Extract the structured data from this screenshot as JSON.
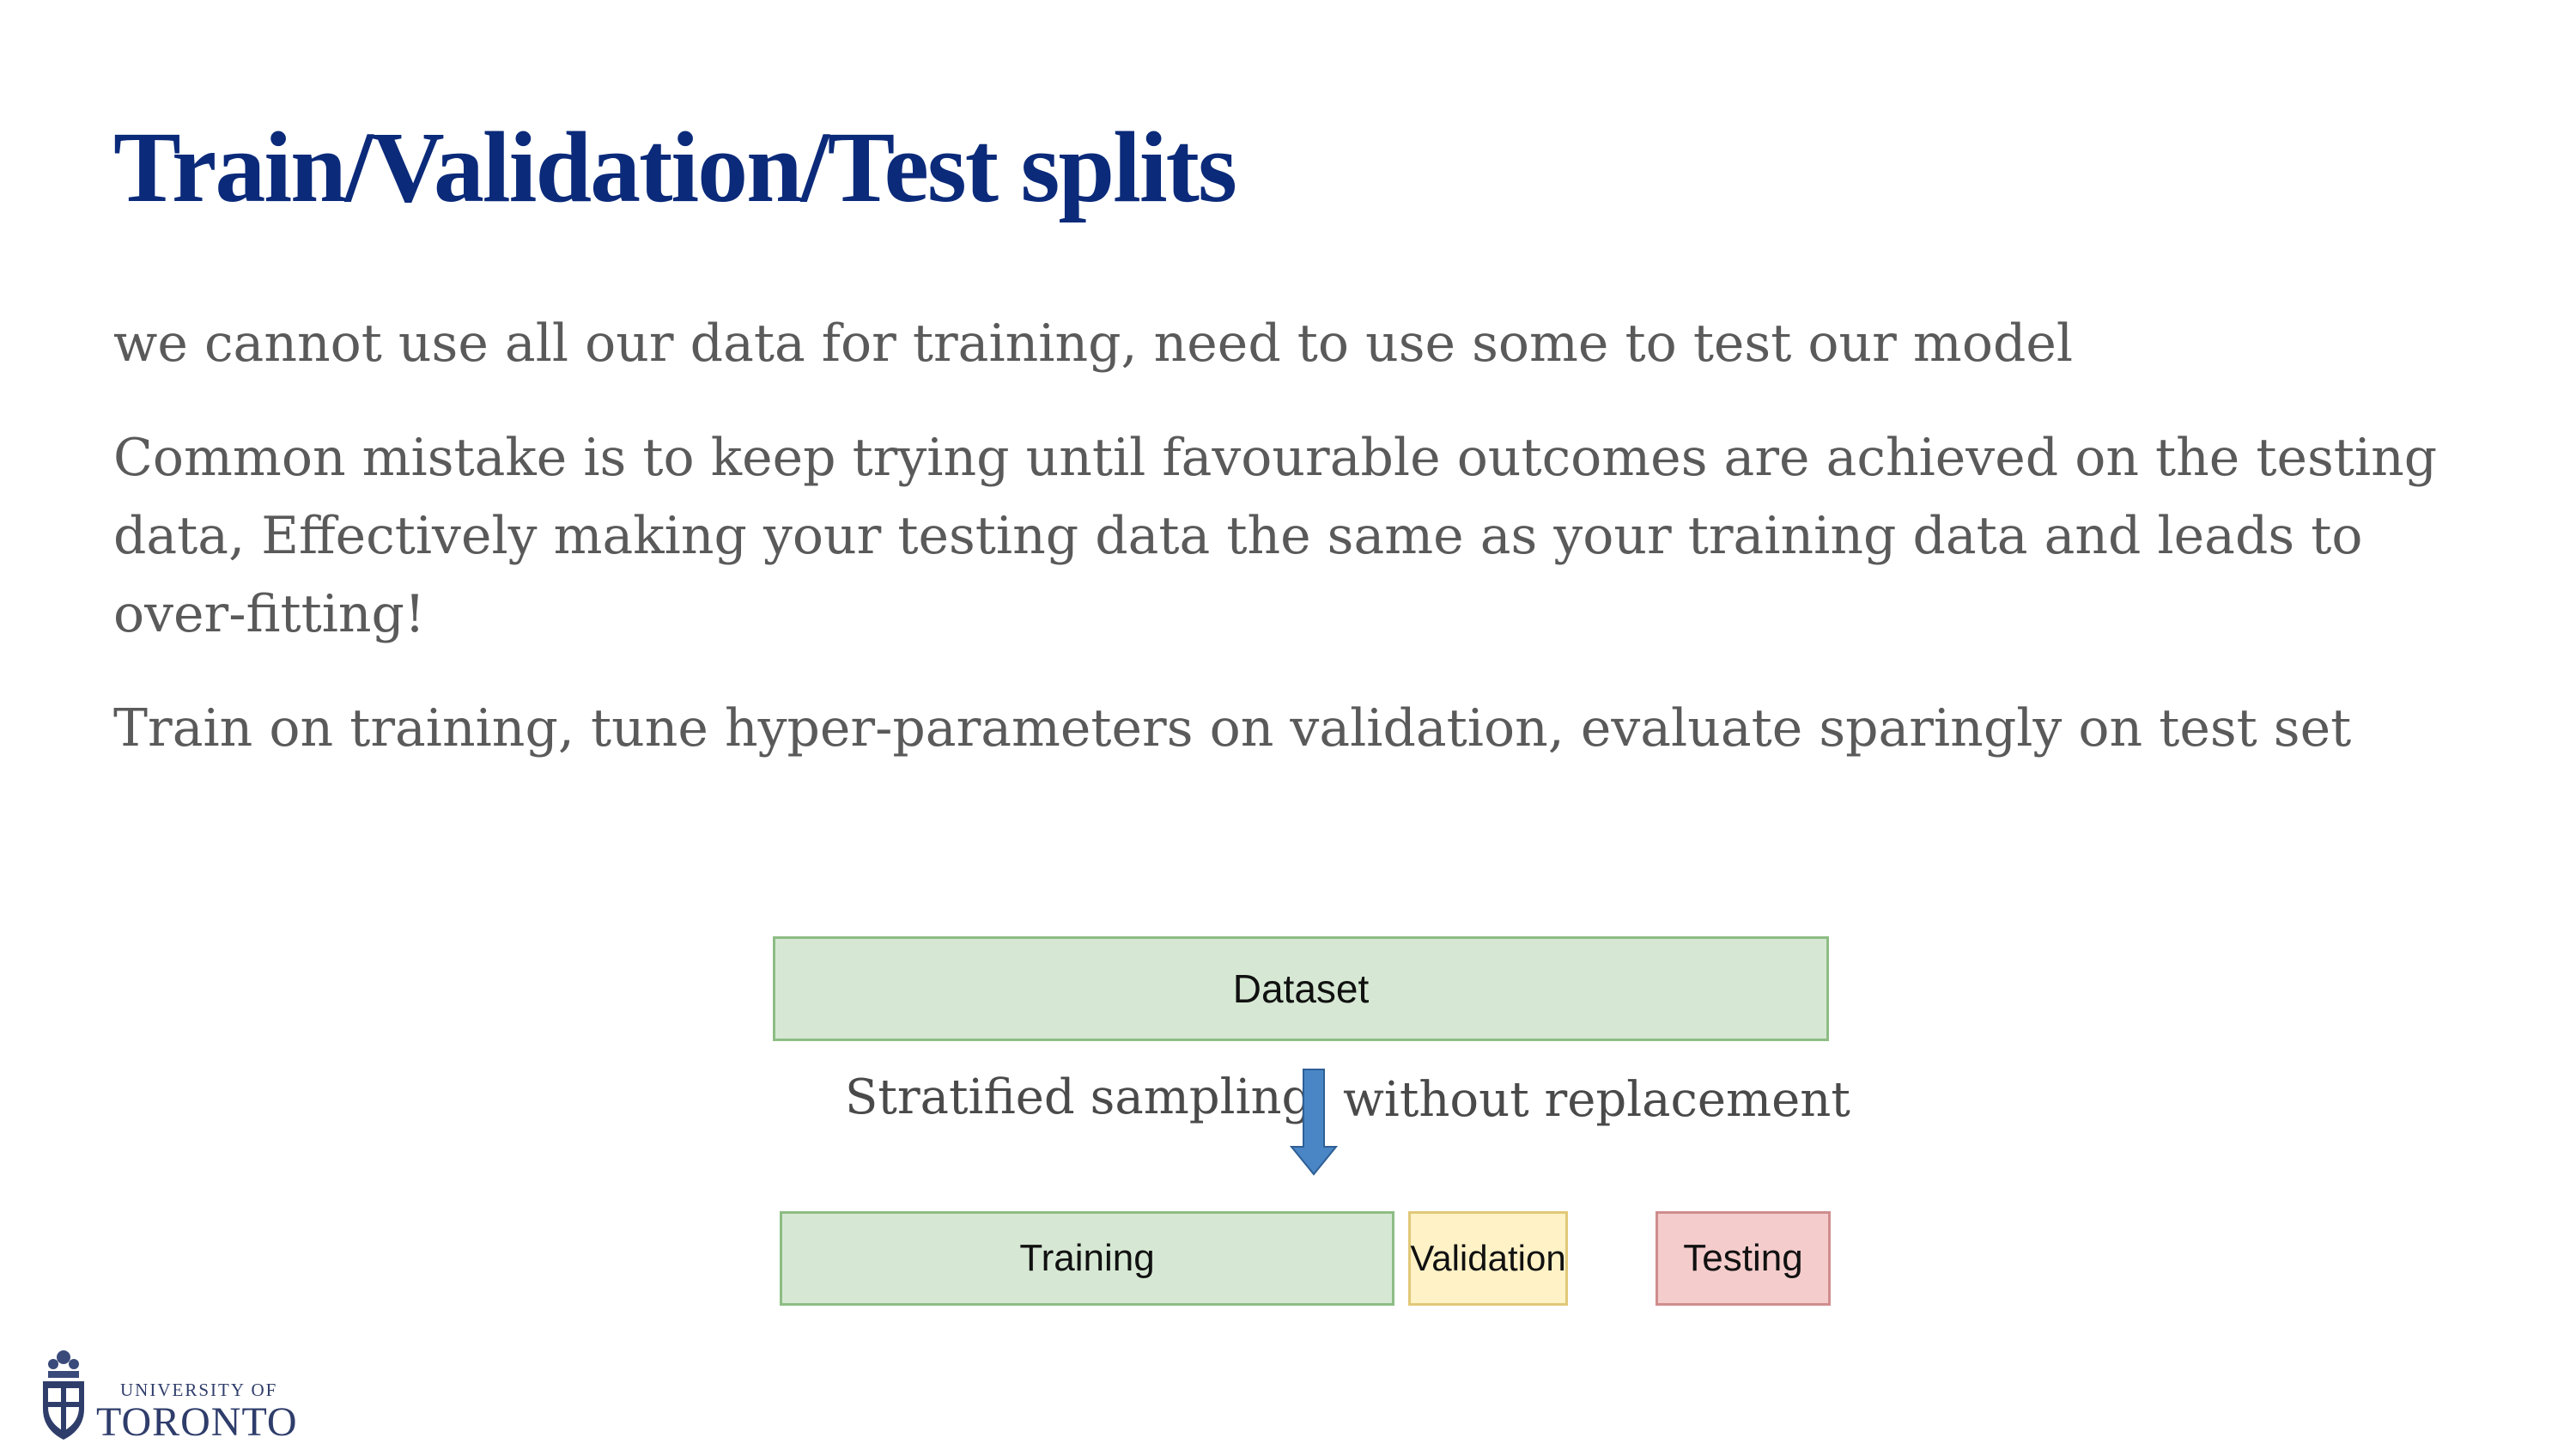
{
  "slide": {
    "title": "Train/Validation/Test splits",
    "bullets": [
      "we cannot use all our data for training, need to use some to test our model",
      "Common mistake is to keep trying until favourable outcomes are achieved on the testing data, Effectively making your testing data the same as your training data and leads to over-fitting!",
      "Train on training, tune hyper-parameters on validation, evaluate sparingly on test set"
    ]
  },
  "diagram": {
    "dataset_label": "Dataset",
    "arrow_left_label": "Stratified sampling",
    "arrow_right_label": "without replacement",
    "training_label": "Training",
    "validation_label": "Validation",
    "testing_label": "Testing",
    "colors": {
      "dataset": "#d6e8d3",
      "training": "#d6e8d3",
      "validation": "#fff2c6",
      "testing": "#f4cccc",
      "arrow": "#4a86c5"
    }
  },
  "logo": {
    "line1": "UNIVERSITY OF",
    "line2": "TORONTO",
    "icon": "university-crest-icon"
  }
}
